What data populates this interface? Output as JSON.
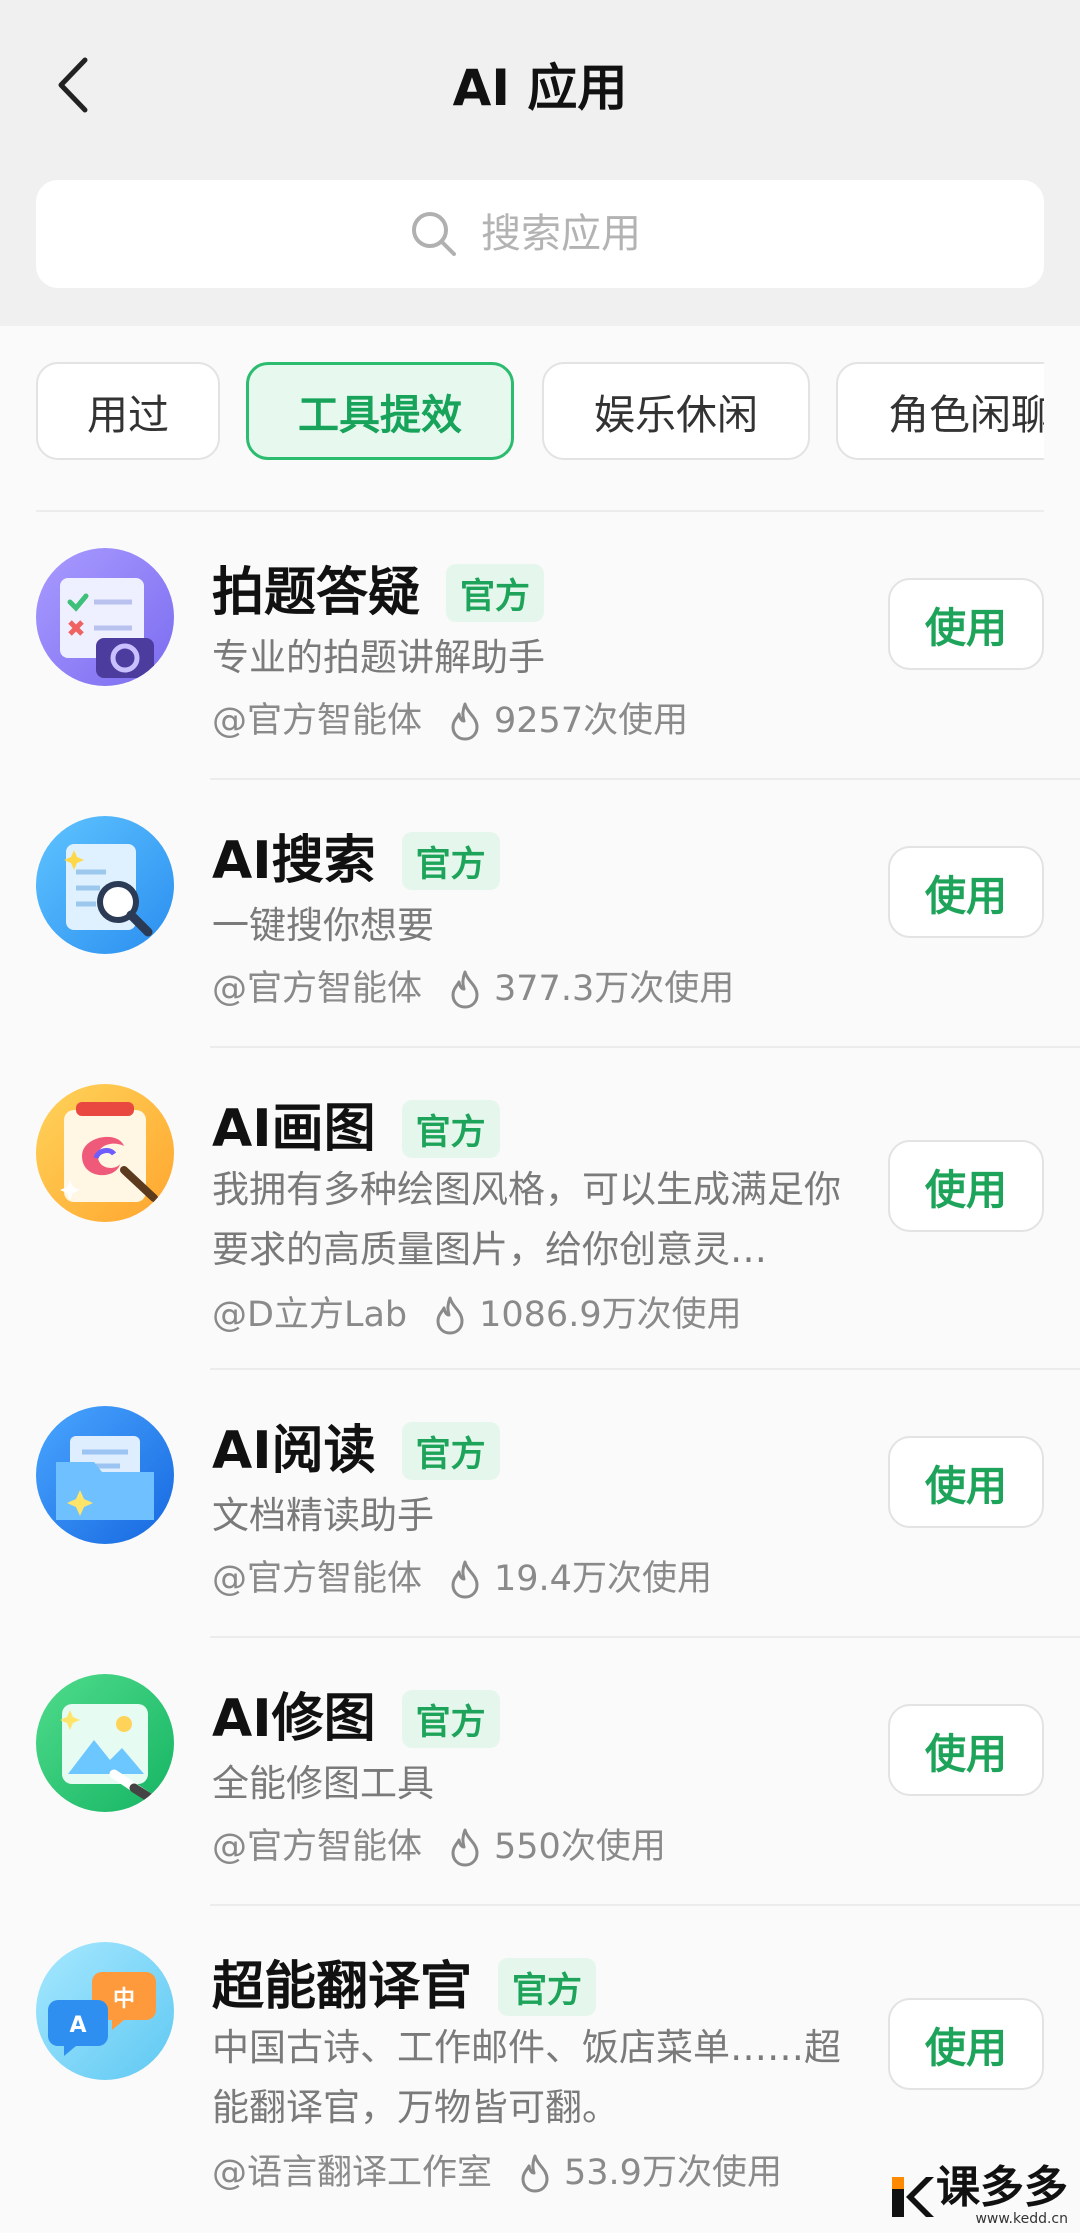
{
  "header": {
    "title": "AI 应用",
    "back_icon": "back-chevron-icon"
  },
  "search": {
    "placeholder": "搜索应用",
    "value": "",
    "icon": "search-icon"
  },
  "tabs": [
    {
      "label": "用过",
      "active": false
    },
    {
      "label": "工具提效",
      "active": true
    },
    {
      "label": "娱乐休闲",
      "active": false
    },
    {
      "label": "角色闲聊",
      "active": false
    }
  ],
  "apps": [
    {
      "name": "拍题答疑",
      "badge": "官方",
      "desc": "专业的拍题讲解助手",
      "author": "@官方智能体",
      "uses": "9257次使用",
      "button": "使用",
      "icon": "photo-question-icon"
    },
    {
      "name": "AI搜索",
      "badge": "官方",
      "desc": "一键搜你想要",
      "author": "@官方智能体",
      "uses": "377.3万次使用",
      "button": "使用",
      "icon": "search-document-icon"
    },
    {
      "name": "AI画图",
      "badge": "官方",
      "desc": "我拥有多种绘图风格，可以生成满足你要求的高质量图片，给你创意灵…",
      "author": "@D立方Lab",
      "uses": "1086.9万次使用",
      "button": "使用",
      "icon": "painting-icon"
    },
    {
      "name": "AI阅读",
      "badge": "官方",
      "desc": "文档精读助手",
      "author": "@官方智能体",
      "uses": "19.4万次使用",
      "button": "使用",
      "icon": "folder-icon"
    },
    {
      "name": "AI修图",
      "badge": "官方",
      "desc": "全能修图工具",
      "author": "@官方智能体",
      "uses": "550次使用",
      "button": "使用",
      "icon": "image-edit-icon"
    },
    {
      "name": "超能翻译官",
      "badge": "官方",
      "desc": "中国古诗、工作邮件、饭店菜单……超能翻译官，万物皆可翻。",
      "author": "@语言翻译工作室",
      "uses": "53.9万次使用",
      "button": "使用",
      "icon": "translate-bubbles-icon"
    }
  ],
  "watermark": {
    "text": "课多多",
    "url": "www.kedd.cn"
  },
  "colors": {
    "accent": "#1ea45a",
    "accent_bg": "#e5f7ec",
    "background": "#fafafa",
    "header_bg": "#f0f0f0"
  }
}
